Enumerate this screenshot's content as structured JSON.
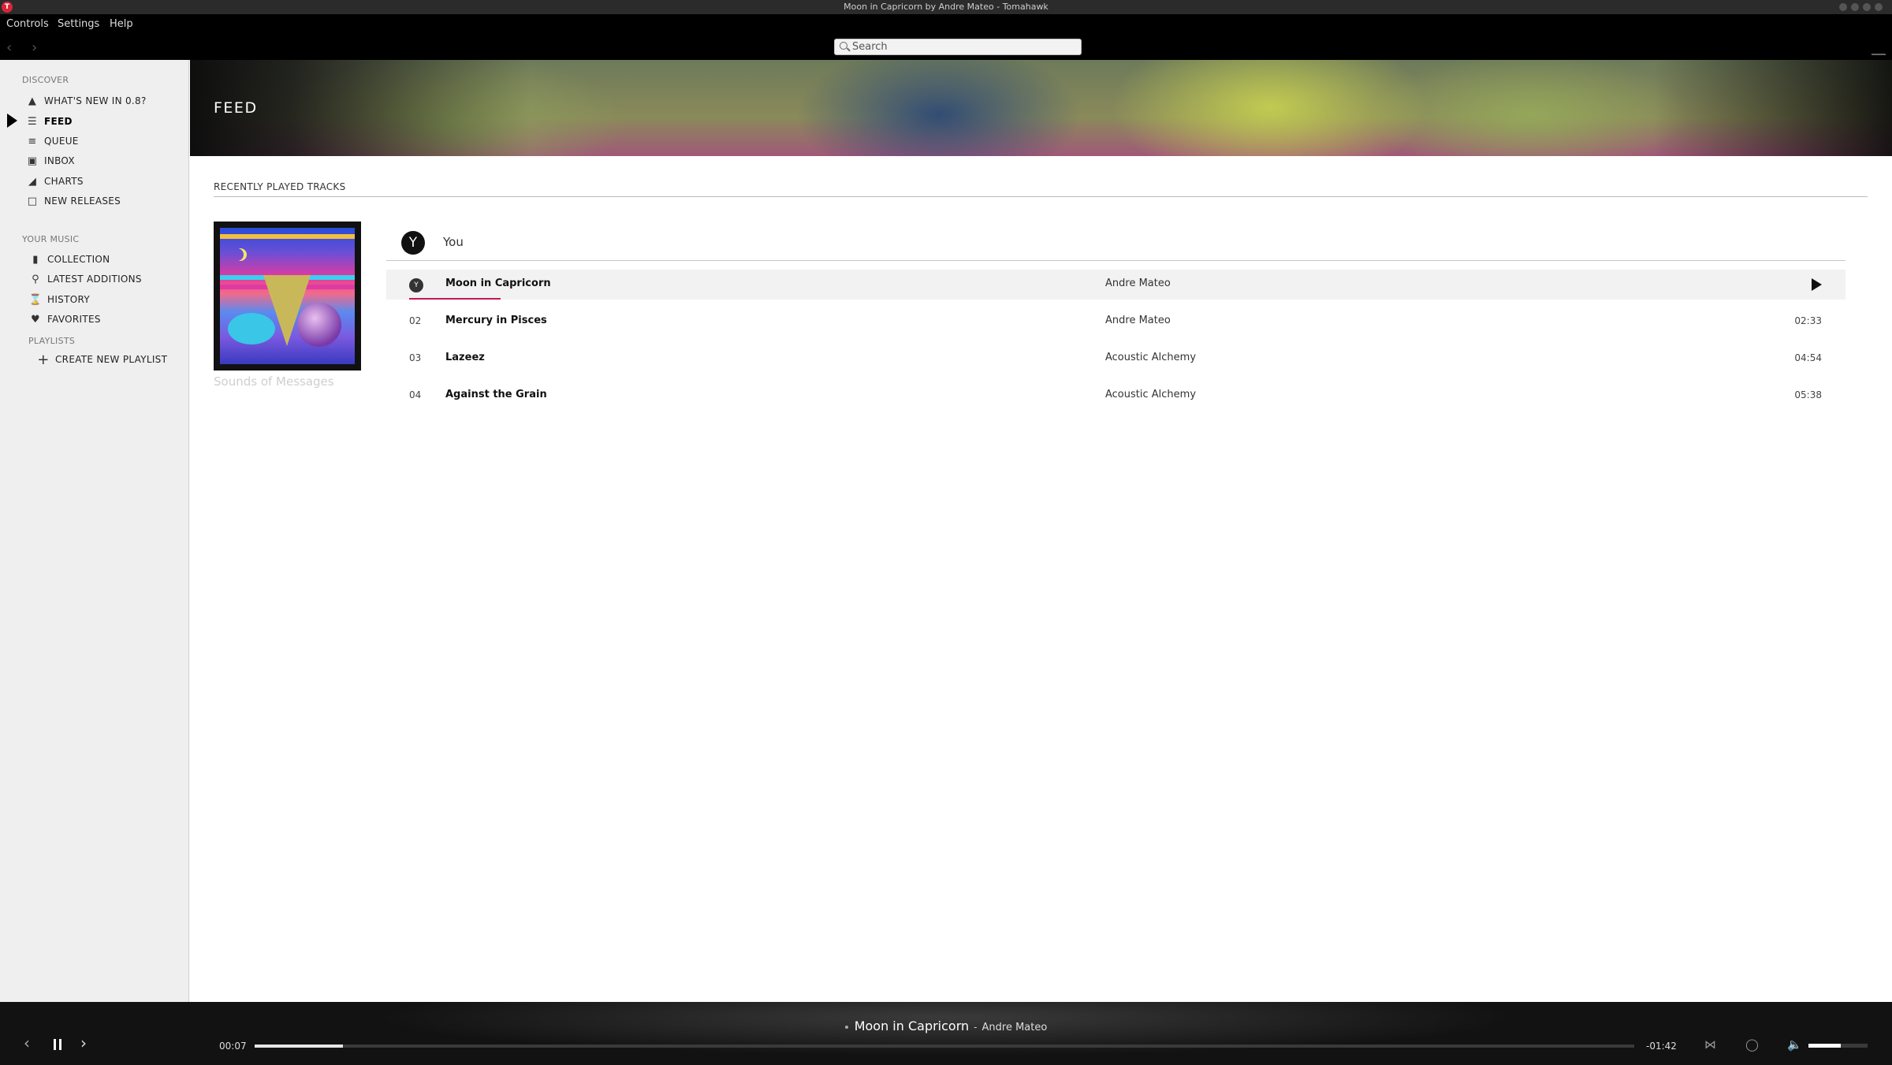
{
  "window": {
    "title": "Moon in Capricorn by Andre Mateo - Tomahawk"
  },
  "menu": [
    "Controls",
    "Settings",
    "Help"
  ],
  "search": {
    "placeholder": "Search"
  },
  "sidebar": {
    "discover_header": "DISCOVER",
    "discover": [
      {
        "label": "WHAT'S NEW IN 0.8?",
        "icon": "tomahawk-icon"
      },
      {
        "label": "FEED",
        "icon": "feed-icon",
        "active": true
      },
      {
        "label": "QUEUE",
        "icon": "queue-icon"
      },
      {
        "label": "INBOX",
        "icon": "inbox-icon"
      },
      {
        "label": "CHARTS",
        "icon": "charts-icon"
      },
      {
        "label": "NEW RELEASES",
        "icon": "calendar-icon"
      }
    ],
    "music_header": "YOUR MUSIC",
    "music": [
      {
        "label": "COLLECTION",
        "icon": "collection-icon"
      },
      {
        "label": "LATEST ADDITIONS",
        "icon": "pin-icon"
      },
      {
        "label": "HISTORY",
        "icon": "hourglass-icon"
      },
      {
        "label": "FAVORITES",
        "icon": "heart-icon"
      }
    ],
    "playlists_header": "PLAYLISTS",
    "create_playlist": "CREATE NEW PLAYLIST"
  },
  "page": {
    "title": "FEED",
    "section_title": "RECENTLY PLAYED TRACKS",
    "album_caption": "Sounds of Messages",
    "user": {
      "initial": "Y",
      "name": "You"
    },
    "tracks": [
      {
        "num": "Y",
        "title": "Moon in Capricorn",
        "artist": "Andre Mateo",
        "duration": "",
        "playing": true
      },
      {
        "num": "02",
        "title": "Mercury in Pisces",
        "artist": "Andre Mateo",
        "duration": "02:33"
      },
      {
        "num": "03",
        "title": "Lazeez",
        "artist": "Acoustic Alchemy",
        "duration": "04:54"
      },
      {
        "num": "04",
        "title": "Against the Grain",
        "artist": "Acoustic Alchemy",
        "duration": "05:38"
      }
    ]
  },
  "player": {
    "track_title": "Moon in Capricorn",
    "separator": "-",
    "artist": "Andre Mateo",
    "elapsed": "00:07",
    "remaining": "-01:42",
    "progress_fraction": 0.064,
    "volume_fraction": 0.55
  },
  "colors": {
    "accent": "#c2185b",
    "sidebar_bg": "#efefef",
    "chrome_bg": "#000000"
  }
}
